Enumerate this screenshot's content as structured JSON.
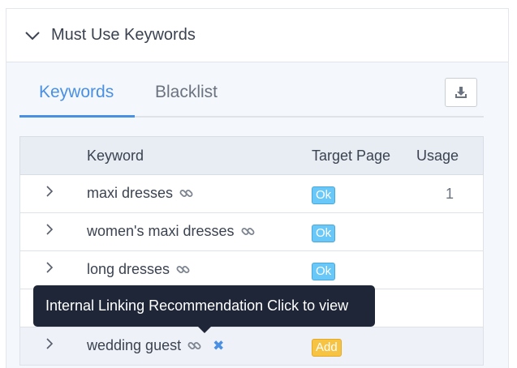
{
  "panel": {
    "title": "Must Use Keywords"
  },
  "tabs": [
    {
      "label": "Keywords",
      "active": true
    },
    {
      "label": "Blacklist",
      "active": false
    }
  ],
  "toolbar": {
    "download_icon": "download-icon"
  },
  "table": {
    "columns": [
      "Keyword",
      "Target Page",
      "Usage"
    ],
    "rows": [
      {
        "keyword": "maxi dresses",
        "target": "Ok",
        "usage": "1"
      },
      {
        "keyword": "women's maxi dresses",
        "target": "Ok",
        "usage": ""
      },
      {
        "keyword": "long dresses",
        "target": "Ok",
        "usage": ""
      },
      {
        "keyword": "",
        "target": "",
        "usage": ""
      },
      {
        "keyword": "wedding guest",
        "target": "Add",
        "usage": ""
      }
    ]
  },
  "tooltip": {
    "text": "Internal Linking Recommendation Click to view"
  },
  "colors": {
    "accent": "#4a90e2",
    "ok_badge": "#69c8f7",
    "add_badge": "#f6c343",
    "tooltip_bg": "#1e2637"
  }
}
